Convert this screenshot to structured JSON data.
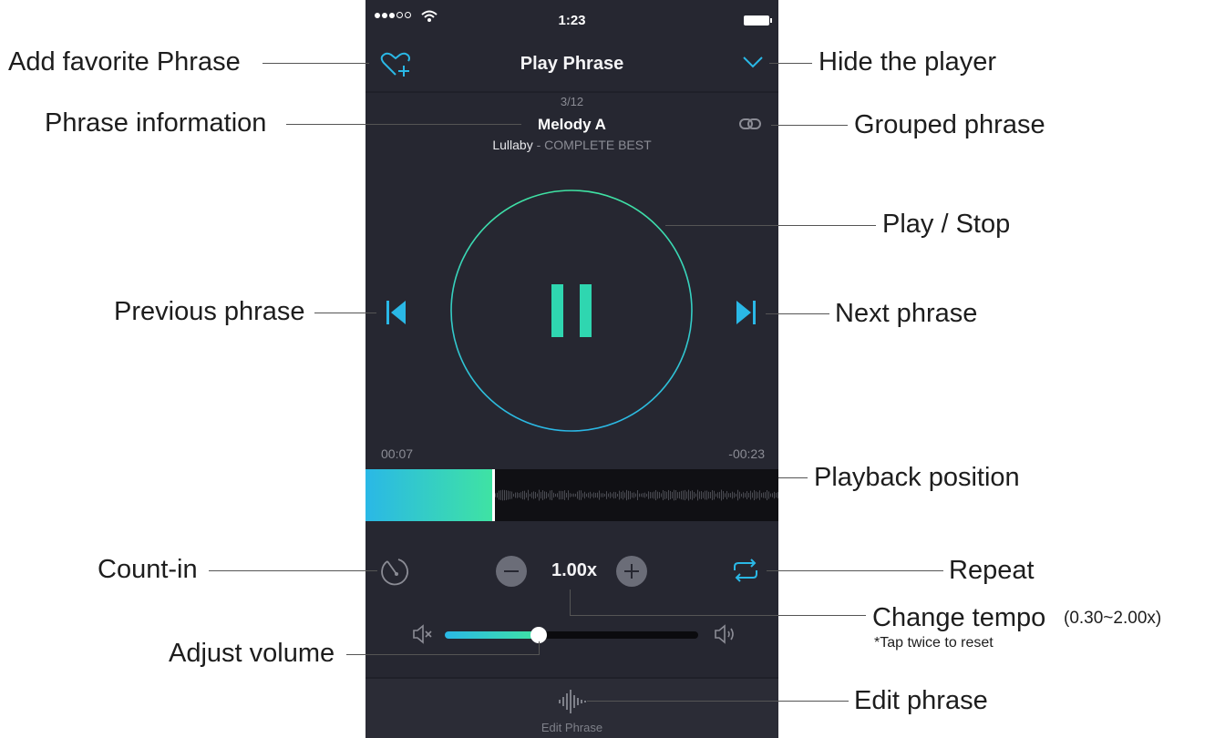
{
  "status_bar": {
    "time": "1:23"
  },
  "nav": {
    "title": "Play Phrase"
  },
  "phrase": {
    "index": "3/12",
    "name": "Melody A",
    "song": "Lullaby",
    "separator": " - ",
    "album": "COMPLETE BEST"
  },
  "playback": {
    "elapsed": "00:07",
    "remaining": "-00:23",
    "position_fraction": 0.31,
    "state": "playing"
  },
  "tempo": {
    "value": "1.00x"
  },
  "volume": {
    "level_fraction": 0.37
  },
  "bottom": {
    "edit_label": "Edit Phrase"
  },
  "colors": {
    "accent": "#2ab8e6",
    "accent2": "#3fe3a3",
    "background": "#262731"
  },
  "icons": [
    "heart-plus-icon",
    "chevron-down-icon",
    "link-icon",
    "pause-icon",
    "skip-previous-icon",
    "skip-next-icon",
    "count-in-icon",
    "minus-icon",
    "plus-icon",
    "repeat-icon",
    "volume-mute-icon",
    "volume-up-icon",
    "waveform-icon"
  ],
  "annotations": {
    "add_favorite": "Add favorite Phrase",
    "hide_player": "Hide the player",
    "phrase_info": "Phrase information",
    "grouped": "Grouped phrase",
    "play_stop": "Play / Stop",
    "previous": "Previous phrase",
    "next": "Next phrase",
    "playback_position": "Playback position",
    "count_in": "Count-in",
    "repeat": "Repeat",
    "change_tempo": "Change tempo",
    "tempo_range": "(0.30~2.00x)",
    "tempo_note": "*Tap twice to reset",
    "adjust_volume": "Adjust volume",
    "edit_phrase": "Edit phrase"
  }
}
